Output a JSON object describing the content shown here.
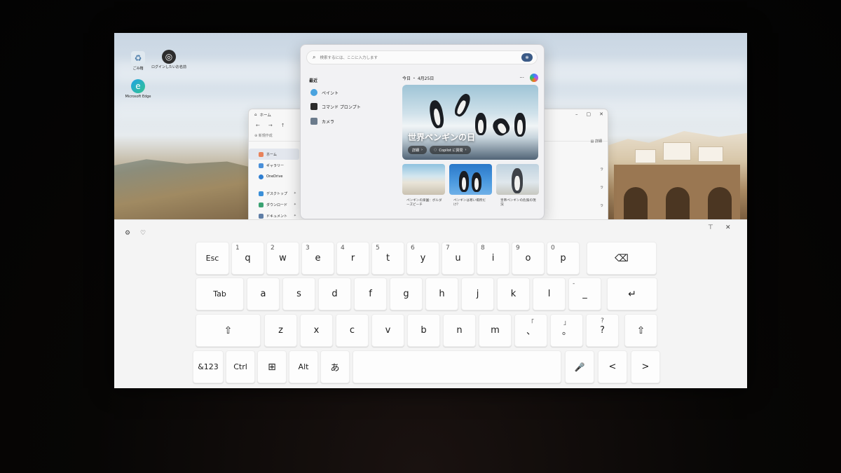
{
  "desktop": {
    "icons": [
      {
        "label": "ごみ箱"
      },
      {
        "label": "ログインしたいお名前"
      },
      {
        "label": "Microsoft Edge"
      }
    ]
  },
  "explorer": {
    "title": "ホーム",
    "new_label": "新規作成",
    "details_label": "詳細",
    "sidebar": [
      {
        "label": "ホーム"
      },
      {
        "label": "ギャラリー"
      },
      {
        "label": "OneDrive"
      },
      {
        "label": "デスクトップ"
      },
      {
        "label": "ダウンロード"
      },
      {
        "label": "ドキュメント"
      }
    ],
    "right_rows": [
      "ラ",
      "ラ",
      "ラ"
    ]
  },
  "start_menu": {
    "search_placeholder": "検索するには、ここに入力します",
    "recent_title": "最近",
    "recent_items": [
      {
        "label": "ペイント",
        "color": "#4aa3df"
      },
      {
        "label": "コマンド プロンプト",
        "color": "#2b2b2b"
      },
      {
        "label": "カメラ",
        "color": "#6b7b8c"
      }
    ],
    "widgets_date": "今日 ・ 4月25日",
    "hero_title": "世界ペンギンの日",
    "hero_btn_details": "詳細",
    "hero_btn_copilot": "Copilot に質問",
    "thumbs": [
      {
        "caption": "ペンギンの楽園：ボルダーズビーチ"
      },
      {
        "caption": "ペンギンは寒い場所だけ？"
      },
      {
        "caption": "皇帝ペンギンの危険の現況"
      }
    ]
  },
  "keyboard": {
    "row1": [
      {
        "label": "Esc"
      },
      {
        "label": "q",
        "num": "1"
      },
      {
        "label": "w",
        "num": "2"
      },
      {
        "label": "e",
        "num": "3"
      },
      {
        "label": "r",
        "num": "4"
      },
      {
        "label": "t",
        "num": "5"
      },
      {
        "label": "y",
        "num": "6"
      },
      {
        "label": "u",
        "num": "7"
      },
      {
        "label": "i",
        "num": "8"
      },
      {
        "label": "o",
        "num": "9"
      },
      {
        "label": "p",
        "num": "0"
      },
      {
        "label": "⌫"
      }
    ],
    "row2": [
      {
        "label": "Tab"
      },
      {
        "label": "a"
      },
      {
        "label": "s"
      },
      {
        "label": "d"
      },
      {
        "label": "f"
      },
      {
        "label": "g"
      },
      {
        "label": "h"
      },
      {
        "label": "j"
      },
      {
        "label": "k"
      },
      {
        "label": "l"
      },
      {
        "label": "_",
        "num": "-"
      },
      {
        "label": "↵"
      }
    ],
    "row3": [
      {
        "label": "⇧"
      },
      {
        "label": "z"
      },
      {
        "label": "x"
      },
      {
        "label": "c"
      },
      {
        "label": "v"
      },
      {
        "label": "b"
      },
      {
        "label": "n"
      },
      {
        "label": "m"
      },
      {
        "label": "、",
        "num": "「"
      },
      {
        "label": "。",
        "num": "」"
      },
      {
        "label": "?",
        "num": "?"
      },
      {
        "label": "⇧"
      }
    ],
    "row4": [
      {
        "label": "&123"
      },
      {
        "label": "Ctrl"
      },
      {
        "label": "⊞"
      },
      {
        "label": "Alt"
      },
      {
        "label": "あ"
      },
      {
        "label": ""
      },
      {
        "label": "🎤"
      },
      {
        "label": "<"
      },
      {
        "label": ">"
      }
    ],
    "top_icons": [
      "settings-icon",
      "emoji-icon",
      "dock-icon",
      "close-icon"
    ]
  }
}
